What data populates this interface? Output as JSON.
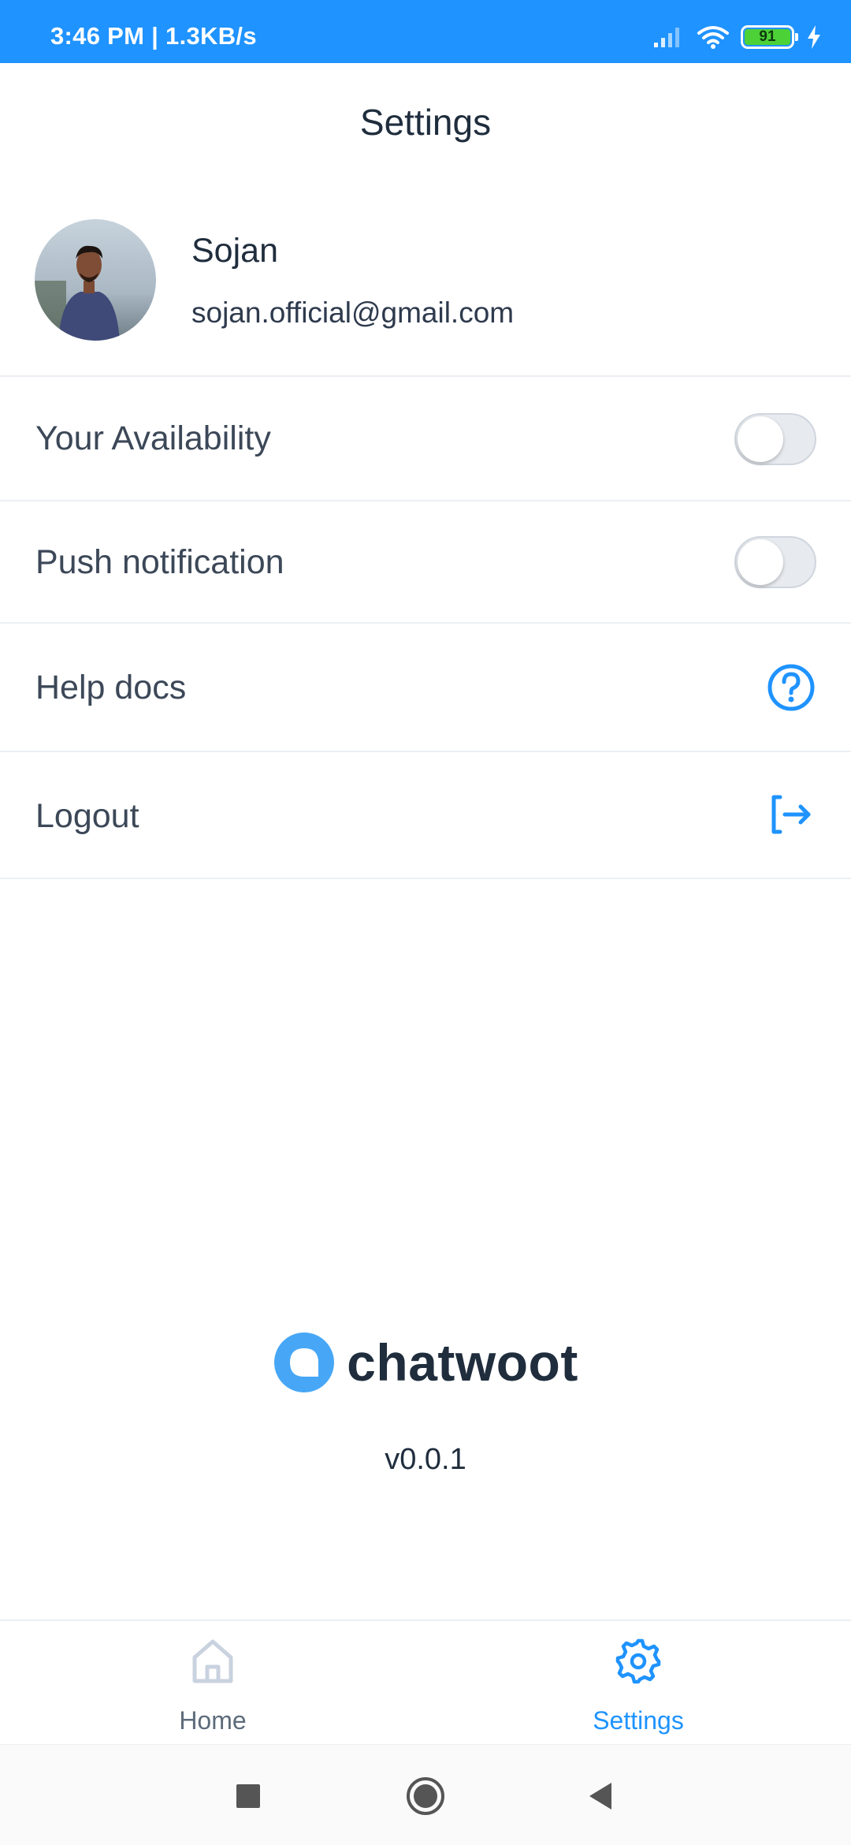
{
  "status_bar": {
    "time_speed": "3:46 PM | 1.3KB/s",
    "battery": "91",
    "icons": [
      "signal-icon",
      "wifi-icon",
      "battery-icon",
      "charging-icon"
    ],
    "background": "#1f93ff"
  },
  "header": {
    "title": "Settings"
  },
  "profile": {
    "name": "Sojan",
    "email": "sojan.official@gmail.com"
  },
  "settings": {
    "availability": {
      "label": "Your Availability",
      "enabled": false
    },
    "push_notification": {
      "label": "Push notification",
      "enabled": false
    },
    "help_docs": {
      "label": "Help docs",
      "icon": "help-circle-icon"
    },
    "logout": {
      "label": "Logout",
      "icon": "logout-icon"
    }
  },
  "brand": {
    "name": "chatwoot",
    "version": "v0.0.1"
  },
  "tabs": [
    {
      "label": "Home",
      "icon": "home-icon",
      "active": false
    },
    {
      "label": "Settings",
      "icon": "gear-icon",
      "active": true
    }
  ],
  "system_nav": [
    "recents-button",
    "home-button",
    "back-button"
  ],
  "colors": {
    "accent": "#1f93ff",
    "text": "#2e3a4d",
    "inactive_tab": "#5d6b7b",
    "divider": "#eceff3"
  }
}
